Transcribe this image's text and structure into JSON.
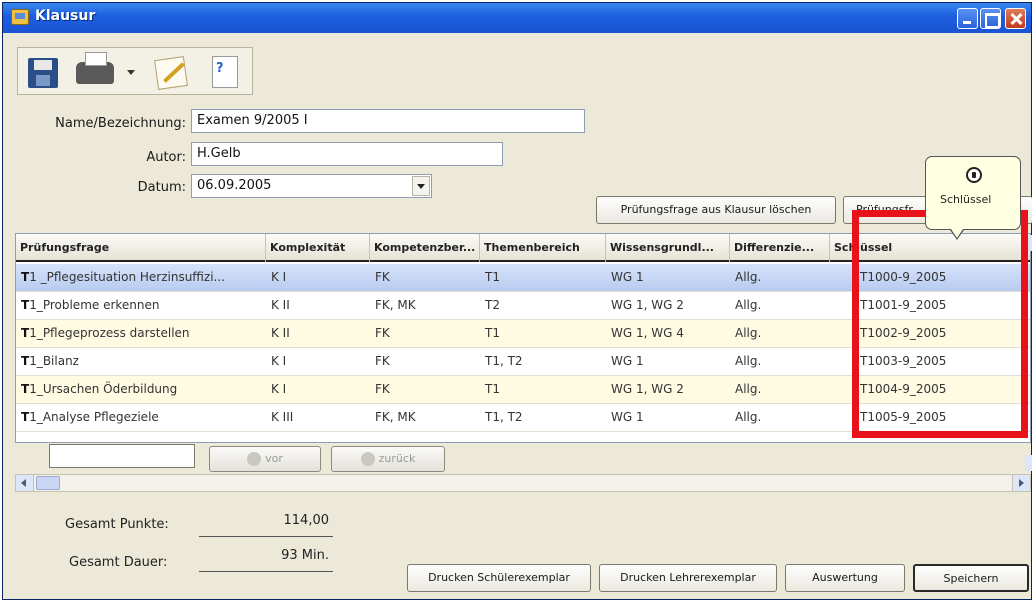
{
  "window": {
    "title": "Klausur"
  },
  "toolbar": {
    "icons": [
      "save-icon",
      "print-icon",
      "dropdown-arrow-icon",
      "edit-icon",
      "new-question-icon"
    ]
  },
  "form": {
    "name_label": "Name/Bezeichnung:",
    "name_value": "Examen 9/2005 I",
    "autor_label": "Autor:",
    "autor_value": "H.Gelb",
    "datum_label": "Datum:",
    "datum_value": "06.09.2005"
  },
  "actions": {
    "delete_label": "Prüfungsfrage aus Klausur löschen",
    "add_label": "Prüfungsfr"
  },
  "tooltip": {
    "text": "Schlüssel"
  },
  "grid": {
    "headers": [
      "Prüfungsfrage",
      "Komplexität",
      "Kompetenzber...",
      "Themenbereich",
      "Wissensgrundl...",
      "Differenzie...",
      "Schlüssel"
    ],
    "rows": [
      {
        "prefix": "T",
        "frage": "1 _Pflegesituation Herzinsuffizi...",
        "komplex": "K I",
        "kompetenz": "FK",
        "thema": "T1",
        "wissen": "WG 1",
        "diff": "Allg.",
        "schluessel": "T1000-9_2005"
      },
      {
        "prefix": "T",
        "frage": "1_Probleme erkennen",
        "komplex": "K II",
        "kompetenz": "FK, MK",
        "thema": "T2",
        "wissen": "WG 1, WG 2",
        "diff": "Allg.",
        "schluessel": "T1001-9_2005"
      },
      {
        "prefix": "T",
        "frage": "1_Pflegeprozess darstellen",
        "komplex": "K II",
        "kompetenz": "FK",
        "thema": "T1",
        "wissen": "WG 1, WG 4",
        "diff": "Allg.",
        "schluessel": "T1002-9_2005"
      },
      {
        "prefix": "T",
        "frage": "1_Bilanz",
        "komplex": "K I",
        "kompetenz": "FK",
        "thema": "T1, T2",
        "wissen": "WG 1",
        "diff": "Allg.",
        "schluessel": "T1003-9_2005"
      },
      {
        "prefix": "T",
        "frage": "1_Ursachen Öderbildung",
        "komplex": "K I",
        "kompetenz": "FK",
        "thema": "T1",
        "wissen": "WG 1, WG 2",
        "diff": "Allg.",
        "schluessel": "T1004-9_2005"
      },
      {
        "prefix": "T",
        "frage": "1_Analyse Pflegeziele",
        "komplex": "K III",
        "kompetenz": "FK, MK",
        "thema": "T1, T2",
        "wissen": "WG 1",
        "diff": "Allg.",
        "schluessel": "T1005-9_2005"
      }
    ]
  },
  "nav": {
    "vor_label": "vor",
    "zurueck_label": "zurück"
  },
  "totals": {
    "punkte_label": "Gesamt Punkte:",
    "punkte_value": "114,00",
    "dauer_label": "Gesamt Dauer:",
    "dauer_value": "93 Min."
  },
  "footer": {
    "druck_schueler": "Drucken Schülerexemplar",
    "druck_lehrer": "Drucken Lehrerexemplar",
    "auswertung": "Auswertung",
    "speichern": "Speichern"
  },
  "colors": {
    "title_bar": "#1c5ee0",
    "highlight": "#e8121b",
    "selected_row": "#b8ccf0",
    "alt_row": "#fffbe3"
  }
}
